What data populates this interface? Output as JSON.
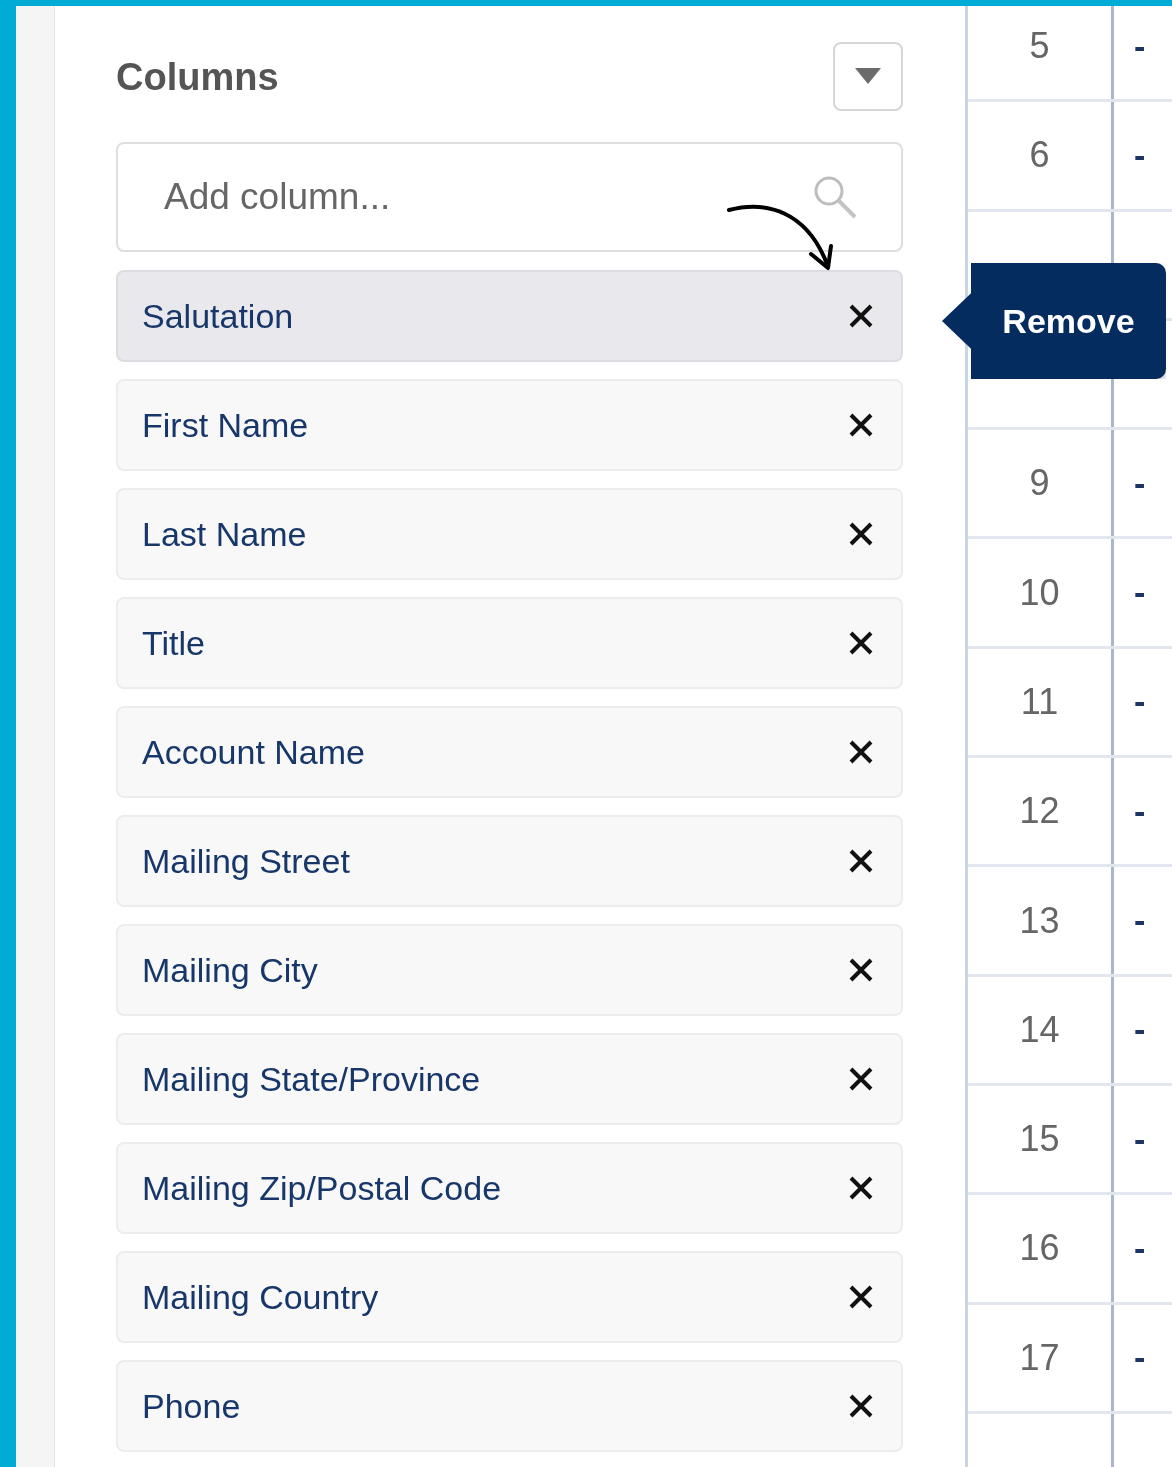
{
  "panel": {
    "title": "Columns",
    "search": {
      "placeholder": "Add column..."
    },
    "columns": [
      {
        "label": "Salutation",
        "selected": true
      },
      {
        "label": "First Name",
        "selected": false
      },
      {
        "label": "Last Name",
        "selected": false
      },
      {
        "label": "Title",
        "selected": false
      },
      {
        "label": "Account Name",
        "selected": false
      },
      {
        "label": "Mailing Street",
        "selected": false
      },
      {
        "label": "Mailing City",
        "selected": false
      },
      {
        "label": "Mailing State/Province",
        "selected": false
      },
      {
        "label": "Mailing Zip/Postal Code",
        "selected": false
      },
      {
        "label": "Mailing Country",
        "selected": false
      },
      {
        "label": "Phone",
        "selected": false
      }
    ]
  },
  "tooltip": {
    "text": "Remove"
  },
  "table": {
    "rows_above_tooltip": [
      {
        "number": "5",
        "value": "-"
      },
      {
        "number": "6",
        "value": "-"
      }
    ],
    "rows_below_tooltip": [
      {
        "number": "9",
        "value": "-"
      },
      {
        "number": "10",
        "value": "-"
      },
      {
        "number": "11",
        "value": "-"
      },
      {
        "number": "12",
        "value": "-"
      },
      {
        "number": "13",
        "value": "-"
      },
      {
        "number": "14",
        "value": "-"
      },
      {
        "number": "15",
        "value": "-"
      },
      {
        "number": "16",
        "value": "-"
      },
      {
        "number": "17",
        "value": "-"
      }
    ]
  }
}
